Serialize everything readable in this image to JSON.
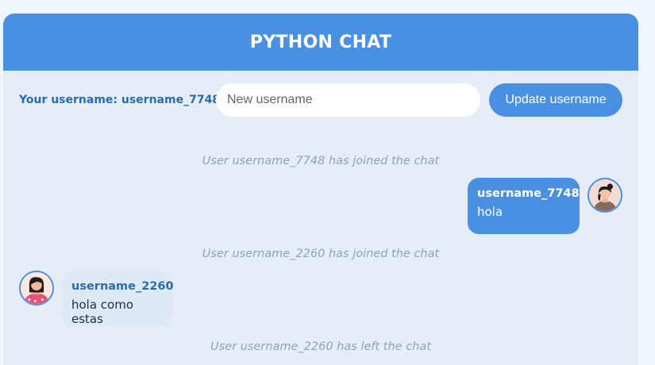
{
  "header": {
    "title": "PYTHON CHAT"
  },
  "user_bar": {
    "current_username_label": "Your username: username_7748",
    "new_username_placeholder": "New username",
    "update_button_label": "Update username"
  },
  "messages": [
    {
      "type": "system",
      "text": "User username_7748 has joined the chat"
    },
    {
      "type": "outgoing",
      "sender": "username_7748",
      "text": "hola",
      "avatar": "avatar-icon-user-7748"
    },
    {
      "type": "system",
      "text": "User username_2260 has joined the chat"
    },
    {
      "type": "incoming",
      "sender": "username_2260",
      "text": "hola como estas",
      "avatar": "avatar-icon-user-2260"
    },
    {
      "type": "system",
      "text": "User username_2260 has left the chat"
    }
  ],
  "colors": {
    "accent": "#4a90e2",
    "panel_bg": "#e5eef7",
    "system_text": "#8fa3b8",
    "username_text": "#2b6cb0"
  }
}
